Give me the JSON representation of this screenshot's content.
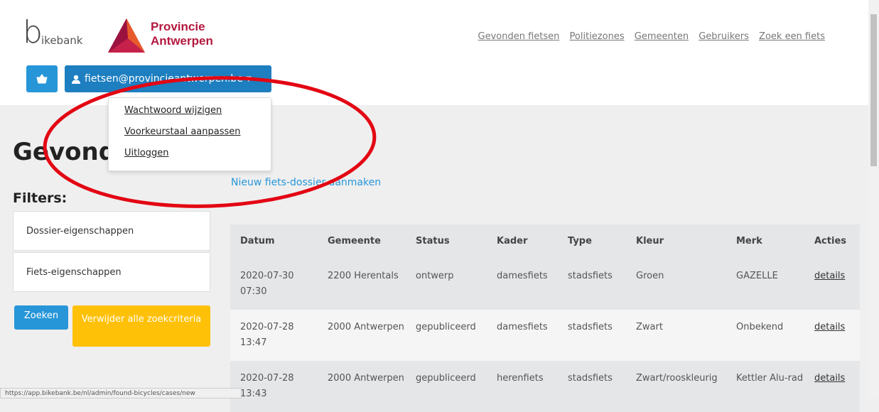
{
  "brand": {
    "bikebank_b": "b",
    "bikebank_text": "ikebank",
    "province_line1": "Provincie",
    "province_line2": "Antwerpen"
  },
  "nav": [
    "Gevonden fietsen",
    "Politiezones",
    "Gemeenten",
    "Gebruikers",
    "Zoek een fiets"
  ],
  "user": {
    "email": "fietsen@provincieantwerpen.be"
  },
  "dropdown": [
    "Wachtwoord wijzigen",
    "Voorkeurstaal aanpassen",
    "Uitloggen"
  ],
  "page": {
    "title": "Gevonden fietsen",
    "filters_heading": "Filters:",
    "new_case_link": "Nieuw fiets-dossier aanmaken"
  },
  "filters": {
    "dossier": "Dossier-eigenschappen",
    "fiets": "Fiets-eigenschappen",
    "search_button": "Zoeken",
    "clear_button": "Verwijder alle zoekcriteria"
  },
  "table": {
    "headers": [
      "Datum",
      "Gemeente",
      "Status",
      "Kader",
      "Type",
      "Kleur",
      "Merk",
      "Acties"
    ],
    "rows": [
      {
        "datum": "2020-07-30 07:30",
        "gemeente": "2200 Herentals",
        "status": "ontwerp",
        "kader": "damesfiets",
        "type": "stadsfiets",
        "kleur": "Groen",
        "merk": "GAZELLE",
        "actie": "details"
      },
      {
        "datum": "2020-07-28 13:47",
        "gemeente": "2000 Antwerpen",
        "status": "gepubliceerd",
        "kader": "damesfiets",
        "type": "stadsfiets",
        "kleur": "Zwart",
        "merk": "Onbekend",
        "actie": "details"
      },
      {
        "datum": "2020-07-28 13:43",
        "gemeente": "2000 Antwerpen",
        "status": "gepubliceerd",
        "kader": "herenfiets",
        "type": "stadsfiets",
        "kleur": "Zwart/rooskleurig",
        "merk": "Kettler Alu-rad",
        "actie": "details"
      }
    ]
  },
  "statusbar": "https://app.bikebank.be/nl/admin/found-bicycles/cases/new",
  "colors": {
    "primary": "#2796d8",
    "primary_dark": "#1d7fc0",
    "warning": "#ffc107",
    "brand_red": "#b3193f",
    "annotation": "#e30613"
  },
  "icons": [
    "basket-icon",
    "user-icon",
    "caret-down-icon"
  ]
}
